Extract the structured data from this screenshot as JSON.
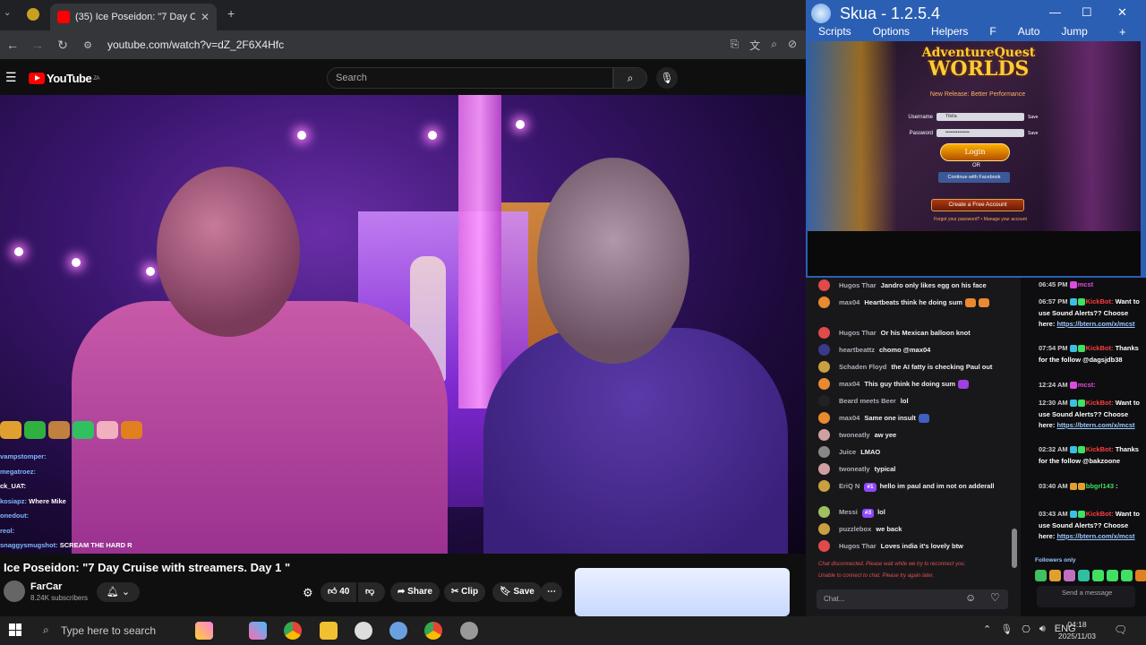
{
  "browser": {
    "tab_title": "(35) Ice Poseidon: \"7 Day Cruise",
    "url": "youtube.com/watch?v=dZ_2F6X4Hfc"
  },
  "youtube": {
    "logo": "YouTube",
    "region": "ZA",
    "search_placeholder": "Search",
    "video_title": "Ice Poseidon: \"7 Day Cruise with streamers. Day 1 \"",
    "channel": "FarCar",
    "subscribers": "8.24K subscribers",
    "likes": "40",
    "share_label": "Share",
    "clip_label": "Clip",
    "save_label": "Save",
    "overlay_chat": [
      {
        "user": "vampstomper:",
        "text": ""
      },
      {
        "user": "megatroez:",
        "text": ""
      },
      {
        "user": "ck_UAT:",
        "text": ""
      },
      {
        "user": "kosiapz:",
        "text": "Where Mike"
      },
      {
        "user": "onedout:",
        "text": ""
      },
      {
        "user": "reol:",
        "text": ""
      },
      {
        "user": "snaggysmugshot:",
        "text": "SCREAM THE HARD R"
      }
    ]
  },
  "skua": {
    "title": "Skua - 1.2.5.4",
    "menu": [
      "Scripts",
      "Options",
      "Helpers",
      "F",
      "Auto",
      "Jump"
    ],
    "game": {
      "logo_line1": "AdventureQuest",
      "logo_line2": "WORLDS",
      "release": "New Release: Better Performance",
      "username_label": "Username",
      "username_value": "Tikila",
      "password_label": "Password",
      "password_value": "••••••••••••••",
      "save_label": "Save",
      "login_label": "Login",
      "or_label": "OR",
      "facebook_label": "Continue with Facebook",
      "create_label": "Create a Free Account",
      "links": "Forgot your password?  •  Manage your account"
    }
  },
  "chat": {
    "messages": [
      {
        "user": "Hugos Thar",
        "text": "Jandro only likes egg on his face",
        "color": "#e04a4a"
      },
      {
        "user": "max04",
        "text": "Heartbeats think he doing sum",
        "color": "#e88a30"
      },
      {
        "user": "Hugos Thar",
        "text": "Or his Mexican balloon knot",
        "color": "#e04a4a"
      },
      {
        "user": "heartbeattz",
        "text": "chomo @max04",
        "color": "#3a3a8a"
      },
      {
        "user": "Schaden Floyd",
        "text": "the AI fatty is checking Paul out",
        "color": "#c8a040"
      },
      {
        "user": "max04",
        "text": "This guy think he doing sum",
        "color": "#e88a30"
      },
      {
        "user": "Beard meets Beer",
        "text": "lol",
        "color": "#222"
      },
      {
        "user": "max04",
        "text": "Same one insult",
        "color": "#e88a30"
      },
      {
        "user": "twoneatly",
        "text": "aw yee",
        "color": "#d0a0a0"
      },
      {
        "user": "Juice",
        "text": "LMAO",
        "color": "#888"
      },
      {
        "user": "twoneatly",
        "text": "typical",
        "color": "#d0a0a0"
      },
      {
        "user": "EriQ N",
        "badge": "#1",
        "text": "hello im paul and im not on adderall",
        "color": "#c8a040"
      },
      {
        "user": "Messi",
        "badge": "#3",
        "text": "lol",
        "color": "#a0c060"
      },
      {
        "user": "puzzlebox",
        "text": "we back",
        "color": "#c8a040"
      },
      {
        "user": "Hugos Thar",
        "text": "Loves india it's lovely btw",
        "color": "#e04a4a"
      }
    ],
    "status_1": "Chat disconnected. Please wait while we try to reconnect you.",
    "status_2": "Unable to connect to chat. Please try again later.",
    "input_placeholder": "Chat..."
  },
  "stream_chat": {
    "messages": [
      {
        "time": "06:45 PM",
        "user": "mcst",
        "text": ""
      },
      {
        "time": "06:57 PM",
        "user": "KickBot:",
        "text": "Want to use Sound Alerts?? Choose here:",
        "link": "https://btern.com/x/mcst"
      },
      {
        "time": "07:54 PM",
        "user": "KickBot:",
        "text": "Thanks for the follow @dagsjdb38"
      },
      {
        "time": "12:24 AM",
        "user": "mcst:",
        "text": ""
      },
      {
        "time": "12:30 AM",
        "user": "KickBot:",
        "text": "Want to use Sound Alerts?? Choose here:",
        "link": "https://btern.com/x/mcst"
      },
      {
        "time": "02:32 AM",
        "user": "KickBot:",
        "text": "Thanks for the follow @bakzoone"
      },
      {
        "time": "03:40 AM",
        "user": "bbgrl143",
        "text": ":"
      },
      {
        "time": "03:43 AM",
        "user": "KickBot:",
        "text": "Want to use Sound Alerts?? Choose here:",
        "link": "https://btern.com/x/mcst"
      }
    ],
    "followers_only": "Followers only",
    "send_placeholder": "Send a message"
  },
  "taskbar": {
    "search_placeholder": "Type here to search",
    "language": "ENG",
    "time": "04:18",
    "date": "2025/11/03"
  }
}
